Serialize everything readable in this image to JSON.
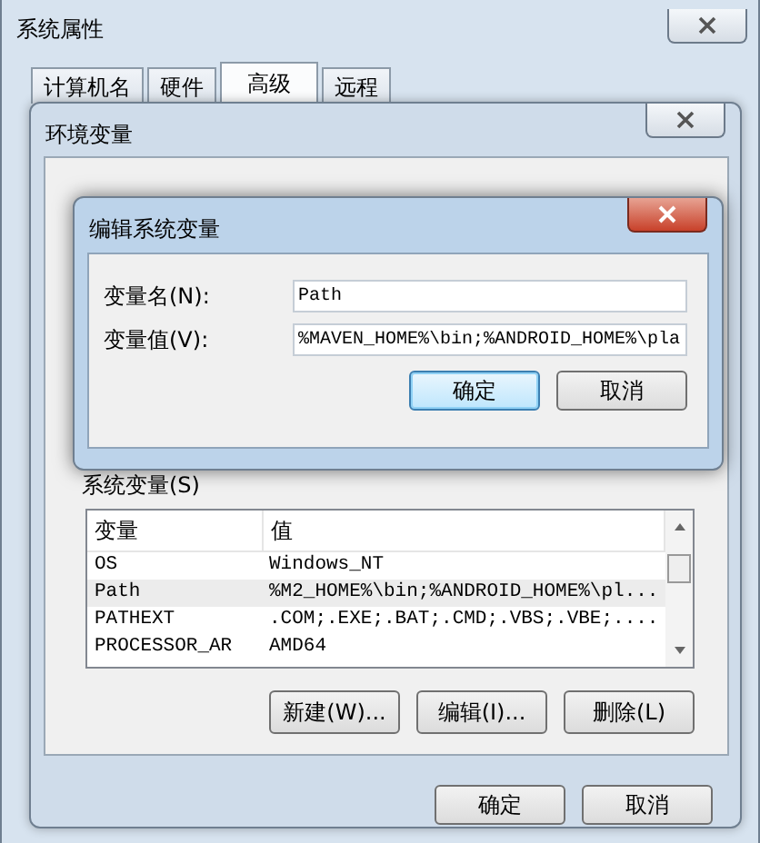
{
  "window": {
    "title": "系统属性"
  },
  "tabs": [
    {
      "label": "计算机名",
      "selected": false
    },
    {
      "label": "硬件",
      "selected": false
    },
    {
      "label": "高级",
      "selected": true
    },
    {
      "label": "远程",
      "selected": false
    }
  ],
  "env_window": {
    "title": "环境变量",
    "system_variables": {
      "label": "系统变量(S)",
      "columns": [
        "变量",
        "值"
      ],
      "rows": [
        {
          "name": "OS",
          "value": "Windows_NT",
          "selected": false
        },
        {
          "name": "Path",
          "value": "%M2_HOME%\\bin;%ANDROID_HOME%\\pl...",
          "selected": true
        },
        {
          "name": "PATHEXT",
          "value": ".COM;.EXE;.BAT;.CMD;.VBS;.VBE;....",
          "selected": false
        },
        {
          "name": "PROCESSOR_AR",
          "value": "AMD64",
          "selected": false
        }
      ],
      "buttons": [
        "新建(W)...",
        "编辑(I)...",
        "删除(L)"
      ]
    },
    "buttons": [
      "确定",
      "取消"
    ]
  },
  "edit_dialog": {
    "title": "编辑系统变量",
    "fields": [
      {
        "label": "变量名(N):",
        "value": "Path"
      },
      {
        "label": "变量值(V):",
        "value": "%MAVEN_HOME%\\bin;%ANDROID_HOME%\\pla"
      }
    ],
    "buttons": [
      {
        "label": "确定",
        "focused": true
      },
      {
        "label": "取消",
        "focused": false
      }
    ]
  }
}
